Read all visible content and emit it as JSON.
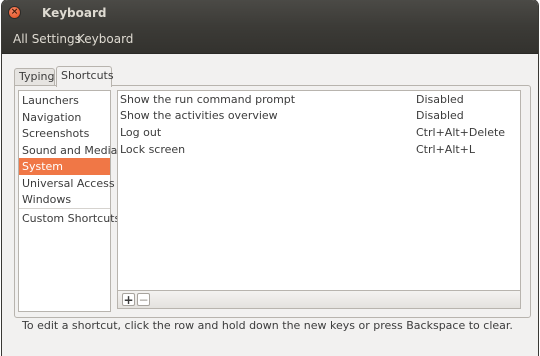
{
  "window": {
    "title": "Keyboard"
  },
  "navbar": {
    "all_settings": "All Settings",
    "current": "Keyboard"
  },
  "tabs": [
    {
      "label": "Typing",
      "active": false
    },
    {
      "label": "Shortcuts",
      "active": true
    }
  ],
  "categories": [
    {
      "label": "Launchers",
      "selected": false
    },
    {
      "label": "Navigation",
      "selected": false
    },
    {
      "label": "Screenshots",
      "selected": false
    },
    {
      "label": "Sound and Media",
      "selected": false
    },
    {
      "label": "System",
      "selected": true
    },
    {
      "label": "Universal Access",
      "selected": false
    },
    {
      "label": "Windows",
      "selected": false
    },
    {
      "label": "Custom Shortcuts",
      "selected": false
    }
  ],
  "shortcuts": [
    {
      "name": "Show the run command prompt",
      "key": "Disabled"
    },
    {
      "name": "Show the activities overview",
      "key": "Disabled"
    },
    {
      "name": "Log out",
      "key": "Ctrl+Alt+Delete"
    },
    {
      "name": "Lock screen",
      "key": "Ctrl+Alt+L"
    }
  ],
  "toolbar": {
    "add": "+",
    "remove": "−"
  },
  "hint": "To edit a shortcut, click the row and hold down the new keys or press Backspace to clear.",
  "icons": {
    "close": "close-icon",
    "minimize": "minimize-icon",
    "maximize": "maximize-icon"
  },
  "colors": {
    "selection": "#f07746",
    "titlebar": "#3c3b37"
  }
}
